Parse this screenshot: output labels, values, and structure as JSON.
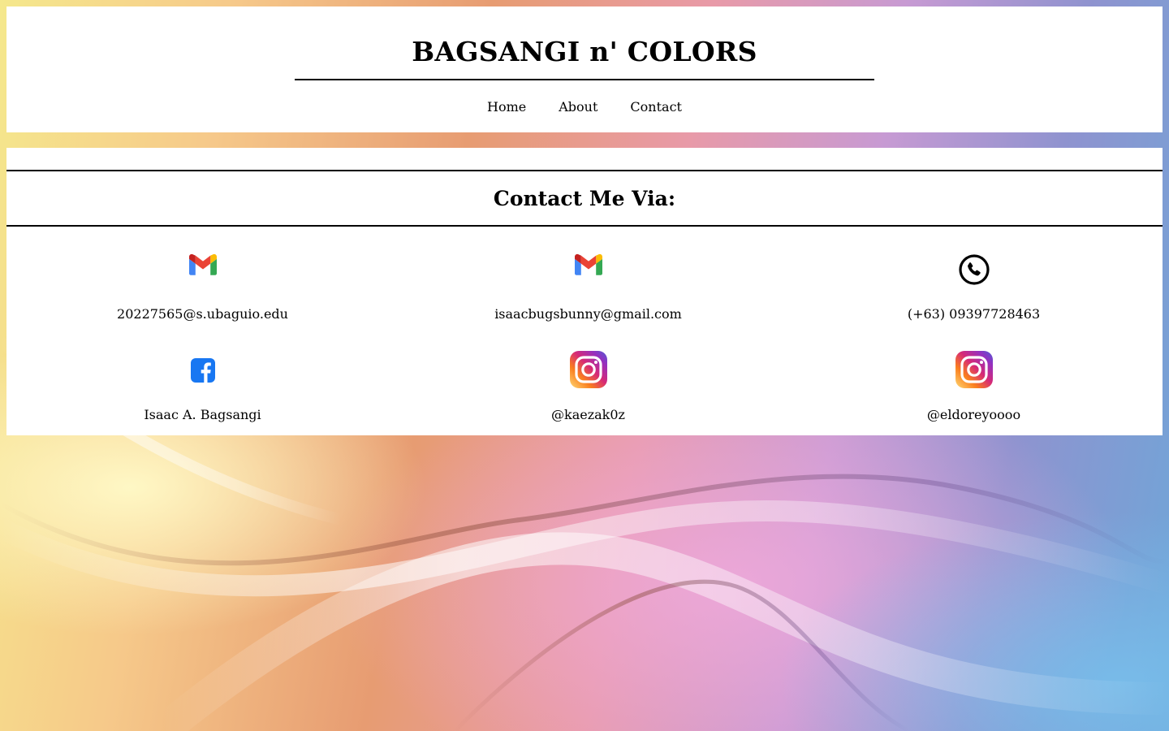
{
  "header": {
    "title": "BAGSANGI n' COLORS",
    "nav": [
      "Home",
      "About",
      "Contact"
    ]
  },
  "contact": {
    "heading": "Contact Me Via:",
    "items": [
      {
        "icon": "gmail-icon",
        "label": "20227565@s.ubaguio.edu"
      },
      {
        "icon": "gmail-icon",
        "label": "isaacbugsbunny@gmail.com"
      },
      {
        "icon": "phone-icon",
        "label": "(+63) 09397728463"
      },
      {
        "icon": "facebook-icon",
        "label": "Isaac A. Bagsangi"
      },
      {
        "icon": "instagram-icon",
        "label": "@kaezak0z"
      },
      {
        "icon": "instagram-icon",
        "label": "@eldoreyoooo"
      }
    ]
  },
  "colors": {
    "panel": "#ffffff",
    "text": "#000000",
    "facebook": "#1877f2",
    "gmail_red": "#ea4335",
    "gmail_blue": "#4285f4",
    "gmail_green": "#34a853",
    "gmail_yellow": "#fbbc04"
  }
}
